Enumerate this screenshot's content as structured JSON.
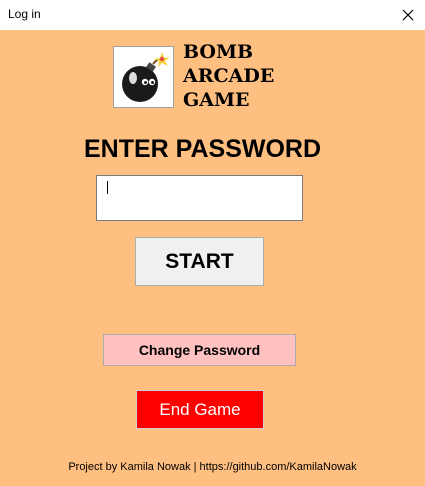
{
  "window": {
    "title": "Log in"
  },
  "logo": {
    "lines": [
      "BOMB",
      "ARCADE",
      "GAME"
    ]
  },
  "login": {
    "heading": "ENTER PASSWORD",
    "password_value": "",
    "start_label": "START",
    "change_password_label": "Change Password",
    "end_game_label": "End Game"
  },
  "footer": {
    "text": "Project by Kamila Nowak | https://github.com/KamilaNowak"
  },
  "colors": {
    "background": "#FFBF80",
    "start_button": "#F0F0F0",
    "change_button": "#FFC0C0",
    "end_button": "#FF0000"
  },
  "icons": {
    "window_close": "close-icon",
    "logo": "bomb-icon"
  }
}
